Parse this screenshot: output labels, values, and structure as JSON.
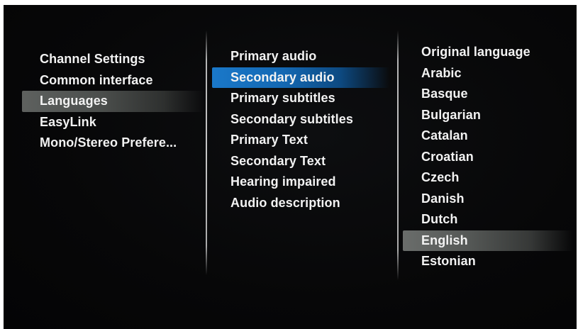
{
  "menu": {
    "categories": [
      {
        "label": "Channel Settings"
      },
      {
        "label": "Common interface"
      },
      {
        "label": "Languages"
      },
      {
        "label": "EasyLink"
      },
      {
        "label": "Mono/Stereo Prefere..."
      }
    ],
    "selected_category": "Languages",
    "language_options": [
      {
        "label": "Primary audio"
      },
      {
        "label": "Secondary audio"
      },
      {
        "label": "Primary subtitles"
      },
      {
        "label": "Secondary subtitles"
      },
      {
        "label": "Primary Text"
      },
      {
        "label": "Secondary Text"
      },
      {
        "label": "Hearing impaired"
      },
      {
        "label": "Audio description"
      }
    ],
    "selected_language_option": "Secondary audio",
    "languages": [
      {
        "label": "Original language"
      },
      {
        "label": "Arabic"
      },
      {
        "label": "Basque"
      },
      {
        "label": "Bulgarian"
      },
      {
        "label": "Catalan"
      },
      {
        "label": "Croatian"
      },
      {
        "label": "Czech"
      },
      {
        "label": "Danish"
      },
      {
        "label": "Dutch"
      },
      {
        "label": "English"
      },
      {
        "label": "Estonian"
      }
    ],
    "selected_language": "English"
  },
  "colors": {
    "background": "#070708",
    "text": "#f2f2f2",
    "focus_highlight": "#1a78c9",
    "selection_highlight": "#5e615f"
  }
}
